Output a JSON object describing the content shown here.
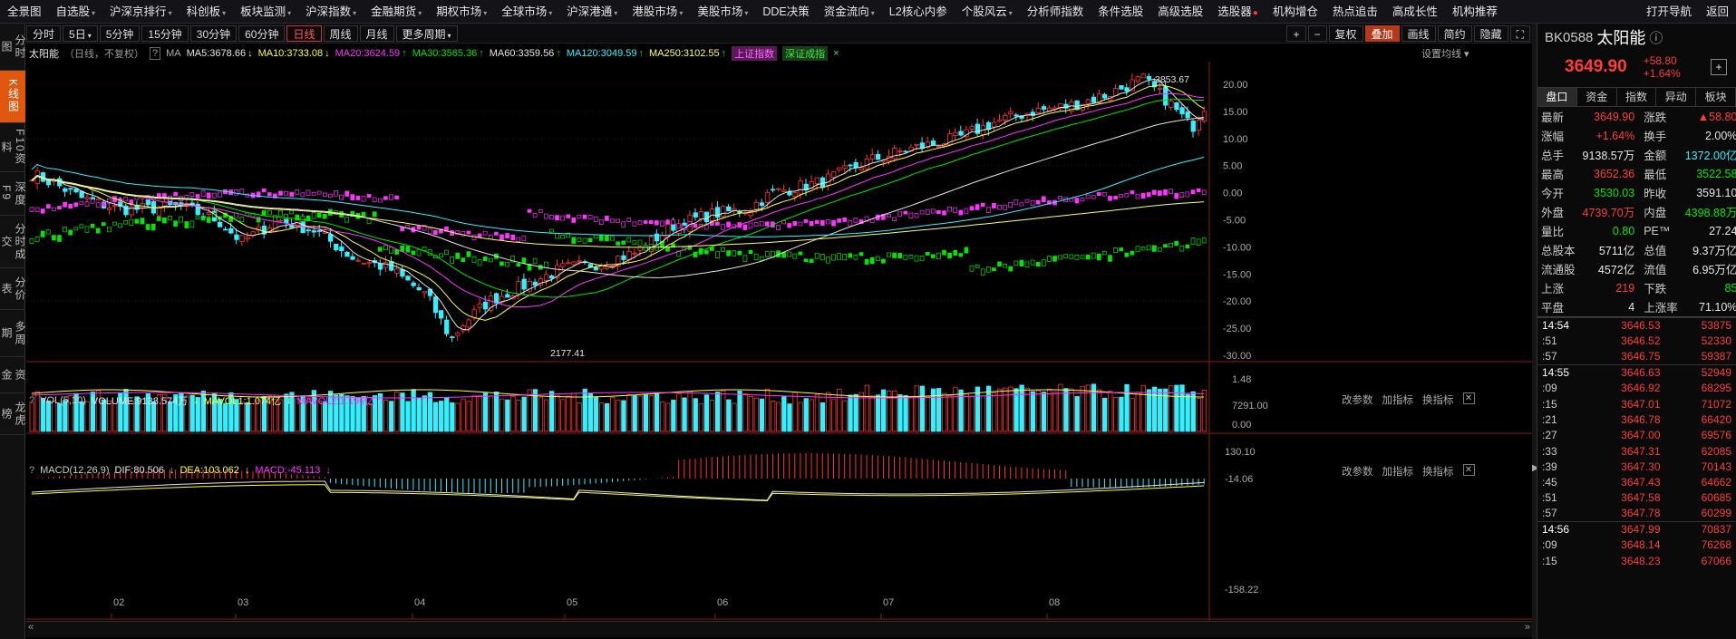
{
  "topbar": {
    "items": [
      {
        "label": "全景图",
        "arrow": false
      },
      {
        "label": "自选股",
        "arrow": true
      },
      {
        "label": "沪深京排行",
        "arrow": true
      },
      {
        "label": "科创板",
        "arrow": true
      },
      {
        "label": "板块监测",
        "arrow": true
      },
      {
        "label": "沪深指数",
        "arrow": true
      },
      {
        "label": "金融期货",
        "arrow": true
      },
      {
        "label": "期权市场",
        "arrow": true
      },
      {
        "label": "全球市场",
        "arrow": true
      },
      {
        "label": "沪深港通",
        "arrow": true
      },
      {
        "label": "港股市场",
        "arrow": true
      },
      {
        "label": "美股市场",
        "arrow": true
      },
      {
        "label": "DDE决策",
        "arrow": false
      },
      {
        "label": "资金流向",
        "arrow": true
      },
      {
        "label": "L2核心内参",
        "arrow": false
      },
      {
        "label": "个股风云",
        "arrow": true
      },
      {
        "label": "分析师指数",
        "arrow": false
      },
      {
        "label": "条件选股",
        "arrow": false
      },
      {
        "label": "高级选股",
        "arrow": false
      },
      {
        "label": "选股器",
        "arrow": false,
        "dot": true
      },
      {
        "label": "机构增仓",
        "arrow": false
      },
      {
        "label": "热点追击",
        "arrow": false
      },
      {
        "label": "高成长性",
        "arrow": false
      },
      {
        "label": "机构推荐",
        "arrow": false
      }
    ],
    "right": [
      "打开导航",
      "返回"
    ]
  },
  "leftnav": [
    {
      "label": "分时图",
      "active": false
    },
    {
      "label": "K线图",
      "active": true
    },
    {
      "label": "F10资料",
      "active": false
    },
    {
      "label": "深度F9",
      "active": false
    },
    {
      "label": "分时成交",
      "active": false
    },
    {
      "label": "分价表",
      "active": false
    },
    {
      "label": "多周期",
      "active": false
    },
    {
      "label": "资金",
      "active": false
    },
    {
      "label": "龙虎榜",
      "active": false
    }
  ],
  "periods": {
    "left": [
      {
        "label": "分时",
        "active": false
      },
      {
        "label": "5日",
        "active": false,
        "arrow": true
      },
      {
        "label": "5分钟",
        "active": false
      },
      {
        "label": "15分钟",
        "active": false
      },
      {
        "label": "30分钟",
        "active": false
      },
      {
        "label": "60分钟",
        "active": false
      },
      {
        "label": "日线",
        "active": true
      },
      {
        "label": "周线",
        "active": false
      },
      {
        "label": "月线",
        "active": false
      },
      {
        "label": "更多周期",
        "active": false,
        "arrow": true
      }
    ],
    "right": [
      "+",
      "−",
      "复权",
      "叠加",
      "画线",
      "简约",
      "隐藏"
    ]
  },
  "legend": {
    "name": "太阳能",
    "sub": "（日线，不复权）",
    "q": "?",
    "ma_prefix": "MA",
    "ma": [
      {
        "label": "MA5:3678.66",
        "dir": "↓",
        "color": "#e6e6e6"
      },
      {
        "label": "MA10:3733.08",
        "dir": "↓",
        "color": "#ffff33"
      },
      {
        "label": "MA20:3624.59",
        "dir": "↑",
        "color": "#ff33ff"
      },
      {
        "label": "MA30:3565.36",
        "dir": "↑",
        "color": "#00e600"
      },
      {
        "label": "MA60:3359.56",
        "dir": "↑",
        "color": "#e6e6e6"
      },
      {
        "label": "MA120:3049.59",
        "dir": "↑",
        "color": "#34f0ff"
      },
      {
        "label": "MA250:3102.55",
        "dir": "↑",
        "color": "#ffff66"
      }
    ],
    "overlay1": "上证指数",
    "overlay2": "深证成指",
    "close_x": "×",
    "set_ma": "设置均线"
  },
  "chart_data": [
    {
      "type": "candlestick",
      "title": "太阳能（日线，不复权）",
      "x_ticks": [
        "02",
        "03",
        "04",
        "05",
        "06",
        "07",
        "08"
      ],
      "right_axis_pct": [
        "20.00",
        "15.00",
        "10.00",
        "5.00",
        "0.00",
        "-5.00",
        "-10.00",
        "-15.00",
        "-20.00",
        "-25.00",
        "-30.00"
      ],
      "annotations": [
        "3853.67",
        "2177.41"
      ],
      "ylim_pct": [
        -32,
        22
      ]
    },
    {
      "type": "bar",
      "title": "VOL(5,10)",
      "legend": [
        "VOLUME:9138.574万",
        "MAVOL1:1.074亿",
        "MAVOL2:1.196亿"
      ],
      "y_ticks": [
        "1.48",
        "7291.00",
        "0.00"
      ]
    },
    {
      "type": "bar",
      "title": "MACD(12,26,9)",
      "legend": [
        "DIF:80.506",
        "DEA:103.062",
        "MACD:-45.113"
      ],
      "y_ticks": [
        "130.10",
        "-14.06",
        "-158.22"
      ]
    }
  ],
  "vol_legend": {
    "title": "VOL(5,10)",
    "volume": "VOLUME:9138.574万",
    "mavol1": "MAVOL1:1.074亿",
    "mavol2": "MAVOL2:1.196亿"
  },
  "macd_legend": {
    "title": "MACD(12,26,9)",
    "dif": "DIF:80.506",
    "dea": "DEA:103.062",
    "macd": "MACD:-45.113"
  },
  "sub_buttons": [
    "改参数",
    "加指标",
    "换指标"
  ],
  "right_panel": {
    "code": "BK0588",
    "name": "太阳能",
    "info_icon": "ⓘ",
    "price": "3649.90",
    "change": "+58.80",
    "change_pct": "+1.64%",
    "plus": "+",
    "tabs": [
      "盘口",
      "资金",
      "指数",
      "异动",
      "板块"
    ],
    "stats": [
      {
        "l1": "最新",
        "v1": "3649.90",
        "c1": "red",
        "l2": "涨跌",
        "v2": "▲58.80",
        "c2": "red"
      },
      {
        "l1": "涨幅",
        "v1": "+1.64%",
        "c1": "red",
        "l2": "换手",
        "v2": "2.00%",
        "c2": "wht"
      },
      {
        "l1": "总手",
        "v1": "9138.57万",
        "c1": "wht",
        "l2": "金额",
        "v2": "1372.00亿",
        "c2": "cyan"
      },
      {
        "l1": "最高",
        "v1": "3652.36",
        "c1": "red",
        "l2": "最低",
        "v2": "3522.58",
        "c2": "grn"
      },
      {
        "l1": "今开",
        "v1": "3530.03",
        "c1": "grn",
        "l2": "昨收",
        "v2": "3591.10",
        "c2": "wht"
      },
      {
        "l1": "外盘",
        "v1": "4739.70万",
        "c1": "red",
        "l2": "内盘",
        "v2": "4398.88万",
        "c2": "grn"
      },
      {
        "l1": "量比",
        "v1": "0.80",
        "c1": "grn",
        "l2": "PE™",
        "v2": "27.24",
        "c2": "wht"
      },
      {
        "l1": "总股本",
        "v1": "5711亿",
        "c1": "wht",
        "l2": "总值",
        "v2": "9.37万亿",
        "c2": "wht"
      },
      {
        "l1": "流通股",
        "v1": "4572亿",
        "c1": "wht",
        "l2": "流值",
        "v2": "6.95万亿",
        "c2": "wht"
      },
      {
        "l1": "上涨",
        "v1": "219",
        "c1": "red",
        "l2": "下跌",
        "v2": "85",
        "c2": "grn"
      },
      {
        "l1": "平盘",
        "v1": "4",
        "c1": "wht",
        "l2": "上涨率",
        "v2": "71.10%",
        "c2": "wht"
      }
    ],
    "ticks": [
      {
        "t": "14:54",
        "p": "3646.53",
        "q": "53875",
        "grp": true
      },
      {
        "t": ":51",
        "p": "3646.52",
        "q": "52330",
        "grp": false
      },
      {
        "t": ":57",
        "p": "3646.75",
        "q": "59387",
        "grp": false
      },
      {
        "t": "14:55",
        "p": "3646.63",
        "q": "52949",
        "grp": true
      },
      {
        "t": ":09",
        "p": "3646.92",
        "q": "68295",
        "grp": false
      },
      {
        "t": ":15",
        "p": "3647.01",
        "q": "71072",
        "grp": false
      },
      {
        "t": ":21",
        "p": "3646.78",
        "q": "66420",
        "grp": false
      },
      {
        "t": ":27",
        "p": "3647.00",
        "q": "69576",
        "grp": false
      },
      {
        "t": ":33",
        "p": "3647.31",
        "q": "62085",
        "grp": false
      },
      {
        "t": ":39",
        "p": "3647.30",
        "q": "70143",
        "grp": false
      },
      {
        "t": ":45",
        "p": "3647.43",
        "q": "64662",
        "grp": false
      },
      {
        "t": ":51",
        "p": "3647.58",
        "q": "60685",
        "grp": false
      },
      {
        "t": ":57",
        "p": "3647.78",
        "q": "60299",
        "grp": false
      },
      {
        "t": "14:56",
        "p": "3647.99",
        "q": "70837",
        "grp": true
      },
      {
        "t": ":09",
        "p": "3648.14",
        "q": "76268",
        "grp": false
      },
      {
        "t": ":15",
        "p": "3648.23",
        "q": "67066",
        "grp": false
      }
    ]
  }
}
